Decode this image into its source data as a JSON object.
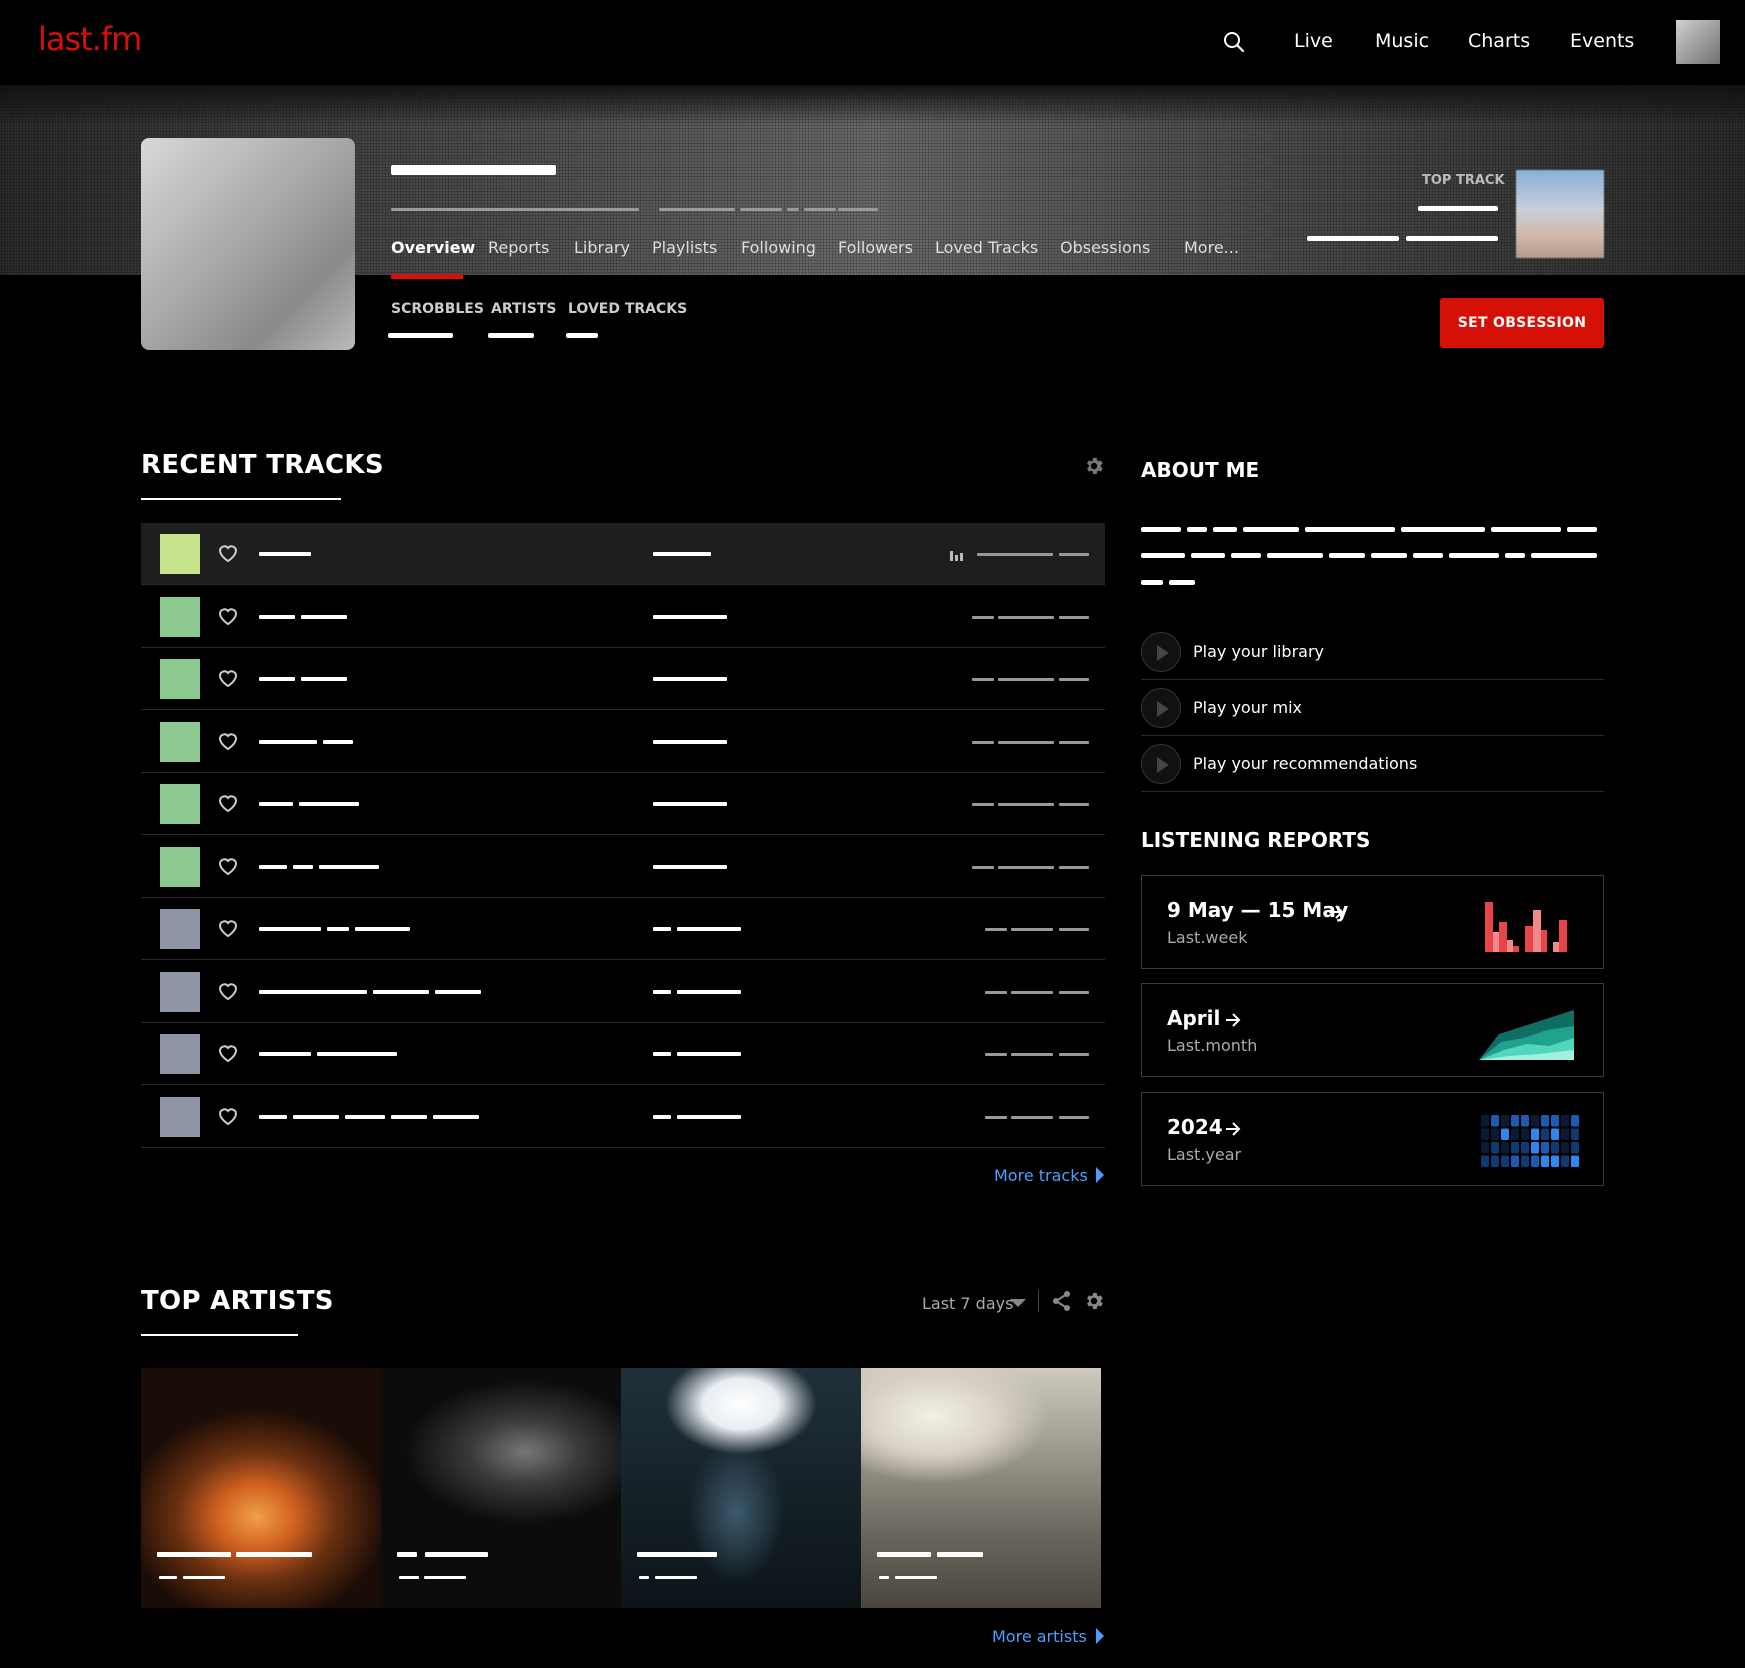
{
  "nav": {
    "logo": "last.fm",
    "links": [
      "Live",
      "Music",
      "Charts",
      "Events"
    ]
  },
  "profile": {
    "tabs": [
      "Overview",
      "Reports",
      "Library",
      "Playlists",
      "Following",
      "Followers",
      "Loved Tracks",
      "Obsessions",
      "More..."
    ],
    "active_tab": "Overview",
    "stats": [
      "SCROBBLES",
      "ARTISTS",
      "LOVED TRACKS"
    ],
    "top_track_label": "TOP TRACK",
    "set_obsession": "SET OBSESSION"
  },
  "recent_tracks": {
    "title": "RECENT TRACKS",
    "more": "More tracks"
  },
  "about": {
    "title": "ABOUT ME",
    "play_items": [
      "Play your library",
      "Play your mix",
      "Play your recommendations"
    ]
  },
  "reports": {
    "title": "LISTENING REPORTS",
    "cards": [
      {
        "title": "9 May — 15 May",
        "sub": "Last.week",
        "chart": "bars-red"
      },
      {
        "title": "April",
        "sub": "Last.month",
        "chart": "area-teal"
      },
      {
        "title": "2024",
        "sub": "Last.year",
        "chart": "grid-blue"
      }
    ]
  },
  "top_artists": {
    "title": "TOP ARTISTS",
    "period": "Last 7 days",
    "more": "More artists"
  },
  "colors": {
    "brand": "#d51007",
    "link": "#4d9fff"
  }
}
